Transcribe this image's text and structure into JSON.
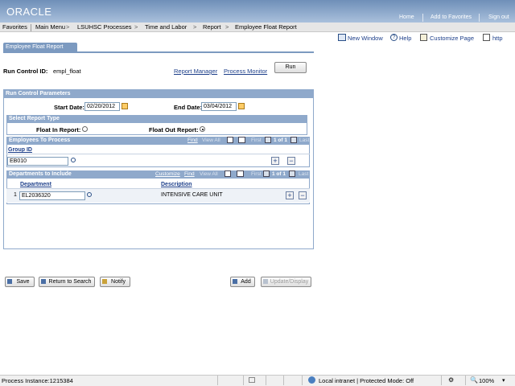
{
  "header": {
    "logo": "ORACLE",
    "links": [
      "Home",
      "Add to Favorites",
      "Sign out"
    ]
  },
  "nav": [
    "Favorites",
    "Main Menu",
    "LSUHSC Processes",
    "Time and Labor",
    "Report",
    "Employee Float Report"
  ],
  "toolbar": {
    "new_window": "New Window",
    "help": "Help",
    "customize": "Customize Page",
    "http": "http"
  },
  "tab": "Employee Float Report",
  "run_control": {
    "label": "Run Control ID:",
    "value": "empl_float",
    "report_manager": "Report Manager",
    "process_monitor": "Process Monitor",
    "run": "Run"
  },
  "params": {
    "title": "Run Control Parameters",
    "start_label": "Start Date:",
    "start_value": "02/20/2012",
    "end_label": "End Date:",
    "end_value": "03/04/2012"
  },
  "report_type": {
    "title": "Select Report Type",
    "float_in": "Float In Report:",
    "float_out": "Float Out Report:",
    "selected": "float_out"
  },
  "employees": {
    "title": "Employees To Process",
    "find": "Find",
    "view_all": "View All",
    "first": "First",
    "count": "1 of 1",
    "last": "Last",
    "col": "Group ID",
    "value": "EB010"
  },
  "departments": {
    "title": "Departments to Include",
    "customize": "Customize",
    "find": "Find",
    "view_all": "View All",
    "first": "First",
    "count": "1 of 1",
    "last": "Last",
    "col_dept": "Department",
    "col_desc": "Description",
    "row_num": "1",
    "dept": "EL2036320",
    "desc": "INTENSIVE CARE UNIT"
  },
  "buttons": {
    "save": "Save",
    "return": "Return to Search",
    "notify": "Notify",
    "add": "Add",
    "update": "Update/Display"
  },
  "status": {
    "process": "Process Instance:1215384",
    "zone": "Local intranet | Protected Mode: Off",
    "zoom": "100%"
  }
}
